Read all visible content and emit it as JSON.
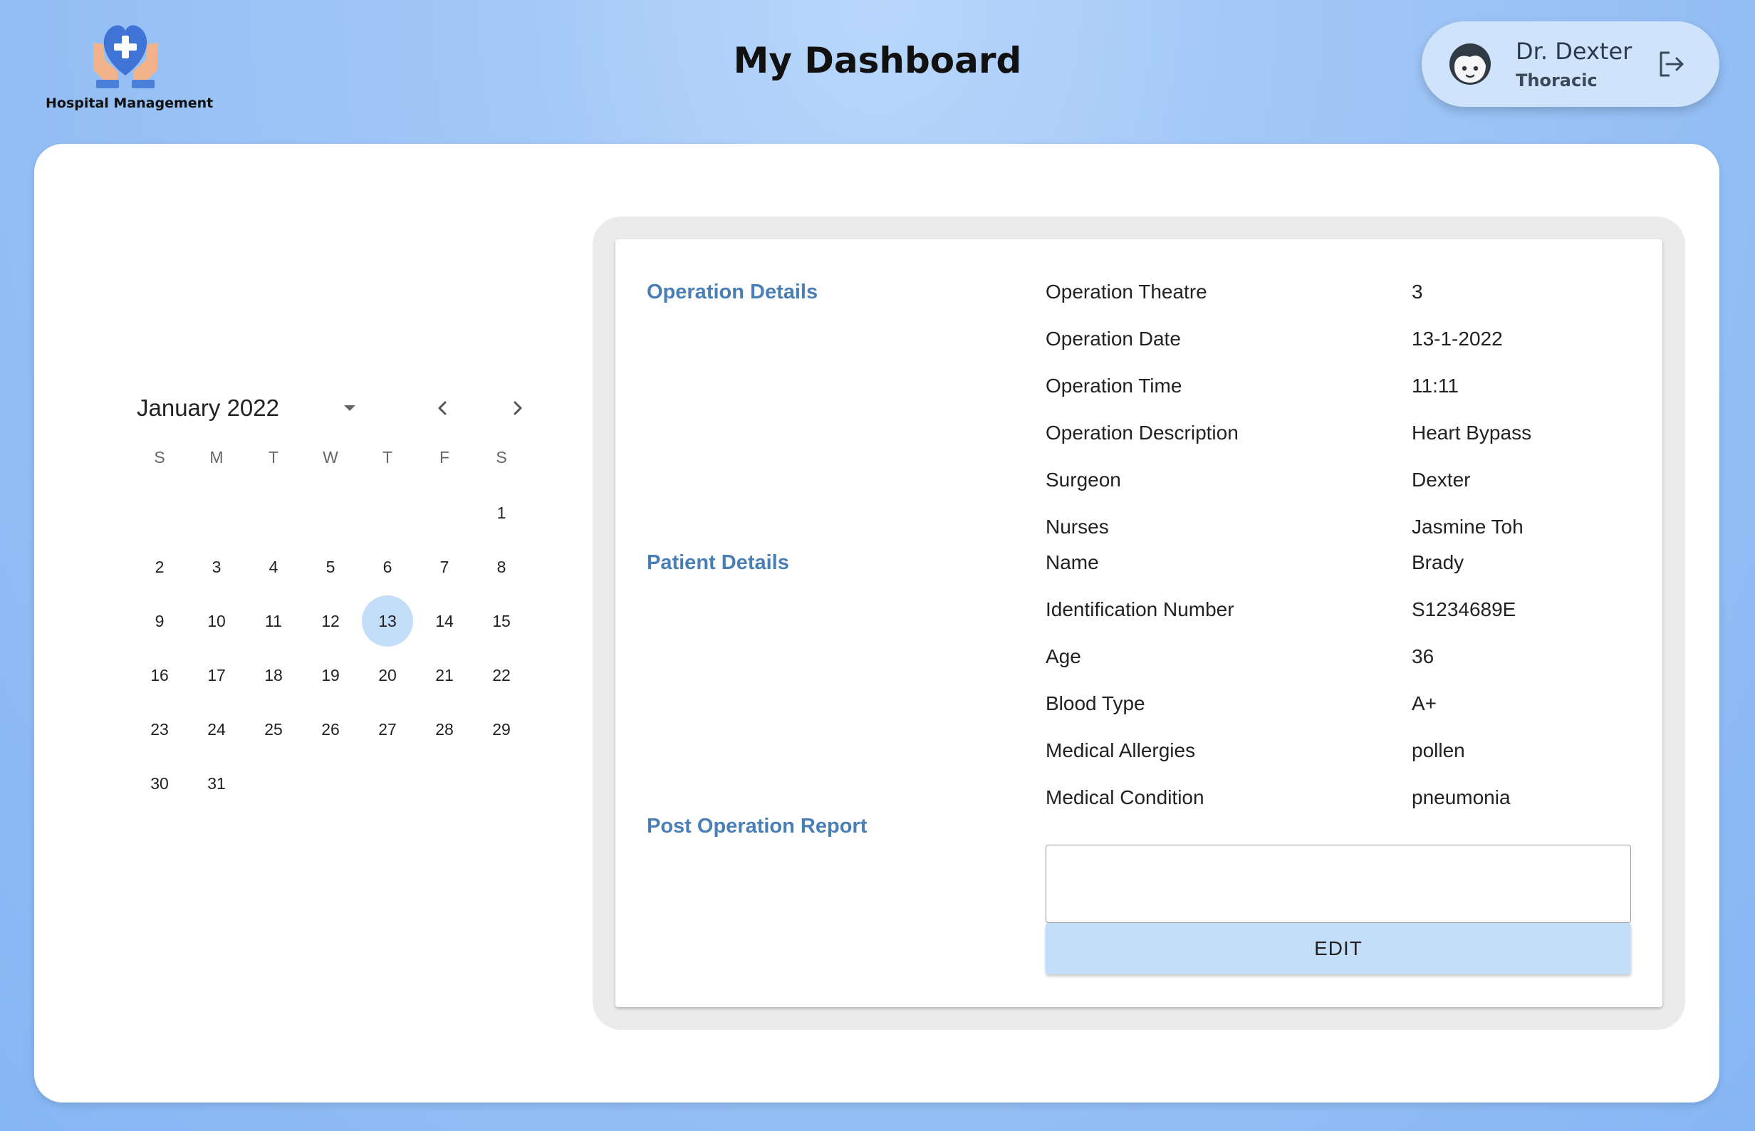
{
  "brand": {
    "name": "Hospital Management",
    "icon": "heart-hands-icon"
  },
  "header": {
    "title": "My Dashboard"
  },
  "user": {
    "name": "Dr. Dexter",
    "department": "Thoracic",
    "avatar_icon": "face-icon",
    "logout_icon": "logout-icon"
  },
  "calendar": {
    "month_label": "January 2022",
    "weekdays": [
      "S",
      "M",
      "T",
      "W",
      "T",
      "F",
      "S"
    ],
    "leading_blanks": 6,
    "days_in_month": 31,
    "selected_day": 13
  },
  "operation": {
    "section_label": "Operation Details",
    "rows": [
      {
        "label": "Operation Theatre",
        "value": "3"
      },
      {
        "label": "Operation Date",
        "value": "13-1-2022"
      },
      {
        "label": "Operation Time",
        "value": "11:11"
      },
      {
        "label": "Operation Description",
        "value": "Heart Bypass"
      },
      {
        "label": "Surgeon",
        "value": "Dexter"
      },
      {
        "label": "Nurses",
        "value": "Jasmine Toh"
      }
    ]
  },
  "patient": {
    "section_label": "Patient Details",
    "rows": [
      {
        "label": "Name",
        "value": "Brady"
      },
      {
        "label": "Identification Number",
        "value": "S1234689E"
      },
      {
        "label": "Age",
        "value": "36"
      },
      {
        "label": "Blood Type",
        "value": "A+"
      },
      {
        "label": "Medical Allergies",
        "value": "pollen"
      },
      {
        "label": "Medical Condition",
        "value": "pneumonia"
      }
    ]
  },
  "report": {
    "section_label": "Post Operation Report",
    "value": "",
    "edit_label": "EDIT"
  },
  "colors": {
    "accent": "#4a7fb5",
    "selected": "#c4ddf9",
    "background": "#9fc5f6"
  }
}
